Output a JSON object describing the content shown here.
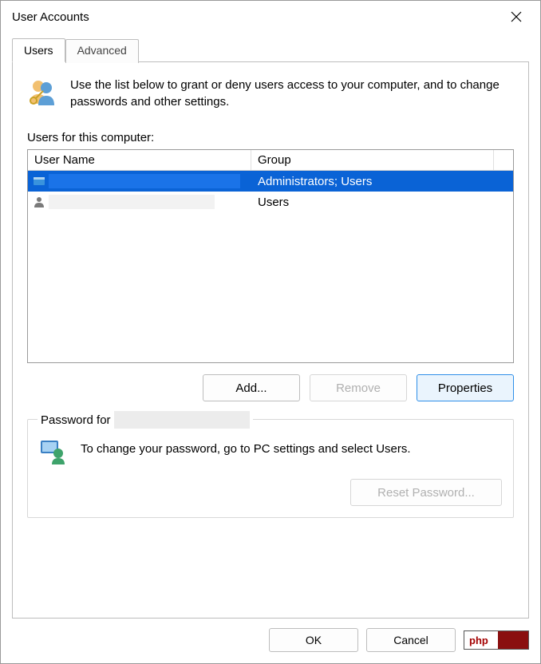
{
  "window": {
    "title": "User Accounts"
  },
  "tabs": {
    "users": "Users",
    "advanced": "Advanced",
    "active": "users"
  },
  "intro": {
    "text": "Use the list below to grant or deny users access to your computer, and to change passwords and other settings."
  },
  "users_section": {
    "label": "Users for this computer:",
    "columns": {
      "username": "User Name",
      "group": "Group"
    },
    "rows": [
      {
        "username": "",
        "group": "Administrators; Users",
        "selected": true
      },
      {
        "username": "",
        "group": "Users",
        "selected": false
      }
    ]
  },
  "buttons": {
    "add": "Add...",
    "remove": "Remove",
    "properties": "Properties"
  },
  "password_section": {
    "legend_prefix": "Password for",
    "legend_user": "",
    "text": "To change your password, go to PC settings and select Users.",
    "reset_label": "Reset Password..."
  },
  "footer": {
    "ok": "OK",
    "cancel": "Cancel"
  },
  "watermark": {
    "label": "php"
  }
}
